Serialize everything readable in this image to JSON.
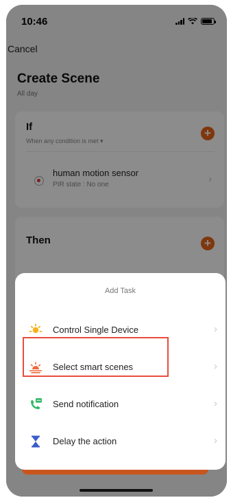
{
  "status_bar": {
    "time": "10:46"
  },
  "header": {
    "cancel_label": "Cancel",
    "title": "Create Scene",
    "subtitle": "All day"
  },
  "if_section": {
    "title": "If",
    "condition_mode": "When any condition is met ▾",
    "conditions": [
      {
        "name": "human motion sensor",
        "detail": "PIR state : No one",
        "icon": "motion-sensor-icon"
      }
    ]
  },
  "then_section": {
    "title": "Then"
  },
  "add_task_sheet": {
    "title": "Add Task",
    "items": [
      {
        "label": "Control Single Device",
        "icon": "sun-icon"
      },
      {
        "label": "Select smart scenes",
        "icon": "sunset-icon"
      },
      {
        "label": "Send notification",
        "icon": "phone-message-icon"
      },
      {
        "label": "Delay the action",
        "icon": "hourglass-icon"
      }
    ],
    "highlighted_item": "Select smart scenes"
  },
  "colors": {
    "accent": "#e8641b",
    "highlight_border": "#e94b3c",
    "notification_green": "#2fb866",
    "delay_blue": "#3b5ccc"
  }
}
